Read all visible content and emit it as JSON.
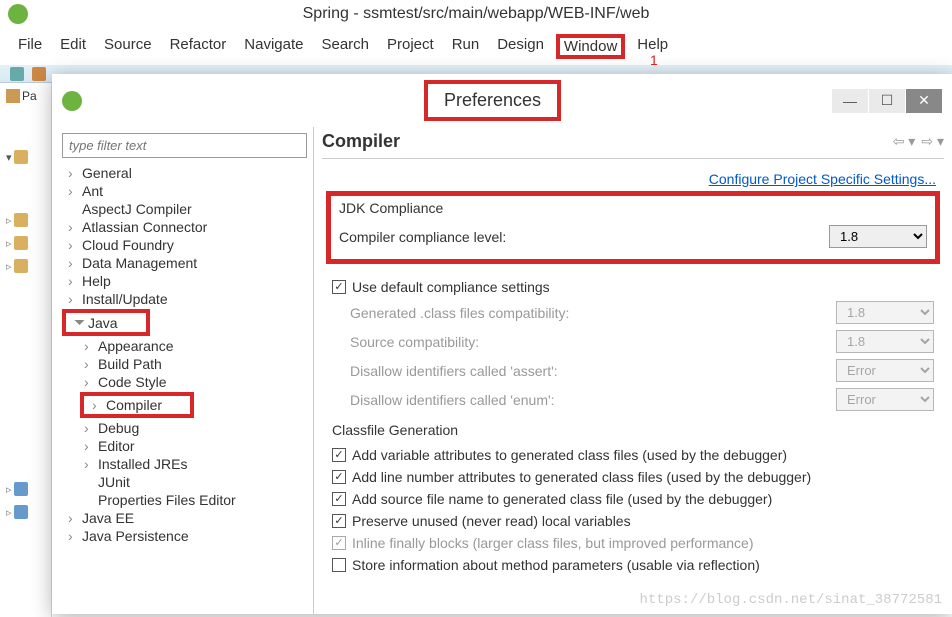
{
  "app": {
    "title": "Spring - ssmtest/src/main/webapp/WEB-INF/web"
  },
  "menubar": {
    "file": "File",
    "edit": "Edit",
    "source": "Source",
    "refactor": "Refactor",
    "navigate": "Navigate",
    "search": "Search",
    "project": "Project",
    "run": "Run",
    "design": "Design",
    "window": "Window",
    "help": "Help",
    "annotation": "1"
  },
  "leftbar": {
    "label": "Pa"
  },
  "pref": {
    "title": "Preferences",
    "filter": {
      "placeholder": "type filter text"
    },
    "tree": {
      "general": "General",
      "ant": "Ant",
      "aspectj": "AspectJ Compiler",
      "atlassian": "Atlassian Connector",
      "cloud": "Cloud Foundry",
      "data": "Data Management",
      "help": "Help",
      "install": "Install/Update",
      "java": "Java",
      "appearance": "Appearance",
      "build": "Build Path",
      "codestyle": "Code Style",
      "compiler": "Compiler",
      "debug": "Debug",
      "editor": "Editor",
      "jres": "Installed JREs",
      "junit": "JUnit",
      "propfiles": "Properties Files Editor",
      "javaee": "Java EE",
      "javapersistence": "Java Persistence"
    },
    "content": {
      "heading": "Compiler",
      "configure_link": "Configure Project Specific Settings...",
      "jdk_group": "JDK Compliance",
      "compliance_label": "Compiler compliance level:",
      "compliance_value": "1.8",
      "use_default": "Use default compliance settings",
      "gen_class": "Generated .class files compatibility:",
      "gen_class_value": "1.8",
      "source_compat": "Source compatibility:",
      "source_compat_value": "1.8",
      "disallow_assert": "Disallow identifiers called 'assert':",
      "disallow_assert_value": "Error",
      "disallow_enum": "Disallow identifiers called 'enum':",
      "disallow_enum_value": "Error",
      "classfile_group": "Classfile Generation",
      "cb1": "Add variable attributes to generated class files (used by the debugger)",
      "cb2": "Add line number attributes to generated class files (used by the debugger)",
      "cb3": "Add source file name to generated class file (used by the debugger)",
      "cb4": "Preserve unused (never read) local variables",
      "cb5": "Inline finally blocks (larger class files, but improved performance)",
      "cb6": "Store information about method parameters (usable via reflection)"
    }
  },
  "watermark": "https://blog.csdn.net/sinat_38772581"
}
